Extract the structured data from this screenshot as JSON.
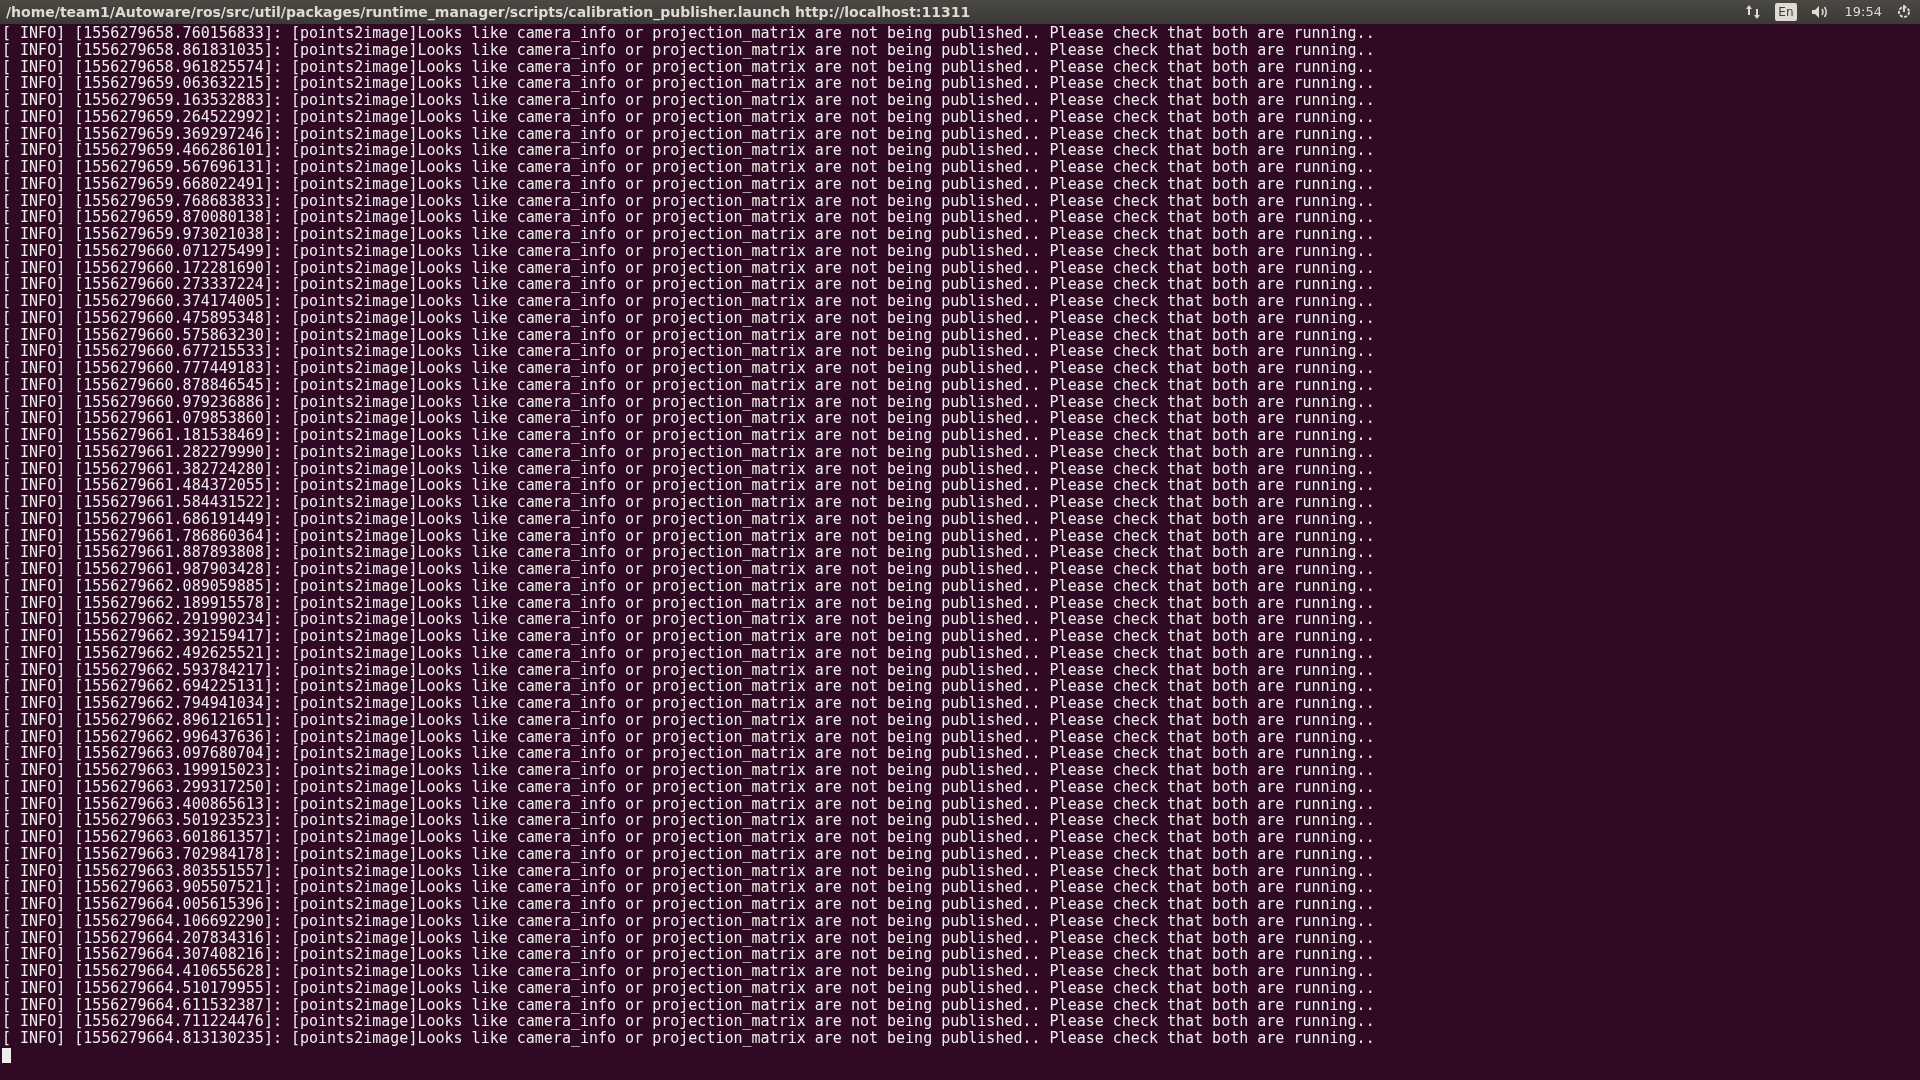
{
  "top_bar": {
    "title": "/home/team1/Autoware/ros/src/util/packages/runtime_manager/scripts/calibration_publisher.launch http://localhost:11311",
    "keyboard_layout": "En",
    "clock": "19:54"
  },
  "terminal": {
    "lines": [
      "[ INFO] [1556279658.760156833]: [points2image]Looks like camera_info or projection_matrix are not being published.. Please check that both are running..",
      "[ INFO] [1556279658.861831035]: [points2image]Looks like camera_info or projection_matrix are not being published.. Please check that both are running..",
      "[ INFO] [1556279658.961825574]: [points2image]Looks like camera_info or projection_matrix are not being published.. Please check that both are running..",
      "[ INFO] [1556279659.063632215]: [points2image]Looks like camera_info or projection_matrix are not being published.. Please check that both are running..",
      "[ INFO] [1556279659.163532883]: [points2image]Looks like camera_info or projection_matrix are not being published.. Please check that both are running..",
      "[ INFO] [1556279659.264522992]: [points2image]Looks like camera_info or projection_matrix are not being published.. Please check that both are running..",
      "[ INFO] [1556279659.369297246]: [points2image]Looks like camera_info or projection_matrix are not being published.. Please check that both are running..",
      "[ INFO] [1556279659.466286101]: [points2image]Looks like camera_info or projection_matrix are not being published.. Please check that both are running..",
      "[ INFO] [1556279659.567696131]: [points2image]Looks like camera_info or projection_matrix are not being published.. Please check that both are running..",
      "[ INFO] [1556279659.668022491]: [points2image]Looks like camera_info or projection_matrix are not being published.. Please check that both are running..",
      "[ INFO] [1556279659.768683833]: [points2image]Looks like camera_info or projection_matrix are not being published.. Please check that both are running..",
      "[ INFO] [1556279659.870080138]: [points2image]Looks like camera_info or projection_matrix are not being published.. Please check that both are running..",
      "[ INFO] [1556279659.973021038]: [points2image]Looks like camera_info or projection_matrix are not being published.. Please check that both are running..",
      "[ INFO] [1556279660.071275499]: [points2image]Looks like camera_info or projection_matrix are not being published.. Please check that both are running..",
      "[ INFO] [1556279660.172281690]: [points2image]Looks like camera_info or projection_matrix are not being published.. Please check that both are running..",
      "[ INFO] [1556279660.273337224]: [points2image]Looks like camera_info or projection_matrix are not being published.. Please check that both are running..",
      "[ INFO] [1556279660.374174005]: [points2image]Looks like camera_info or projection_matrix are not being published.. Please check that both are running..",
      "[ INFO] [1556279660.475895348]: [points2image]Looks like camera_info or projection_matrix are not being published.. Please check that both are running..",
      "[ INFO] [1556279660.575863230]: [points2image]Looks like camera_info or projection_matrix are not being published.. Please check that both are running..",
      "[ INFO] [1556279660.677215533]: [points2image]Looks like camera_info or projection_matrix are not being published.. Please check that both are running..",
      "[ INFO] [1556279660.777449183]: [points2image]Looks like camera_info or projection_matrix are not being published.. Please check that both are running..",
      "[ INFO] [1556279660.878846545]: [points2image]Looks like camera_info or projection_matrix are not being published.. Please check that both are running..",
      "[ INFO] [1556279660.979236886]: [points2image]Looks like camera_info or projection_matrix are not being published.. Please check that both are running..",
      "[ INFO] [1556279661.079853860]: [points2image]Looks like camera_info or projection_matrix are not being published.. Please check that both are running..",
      "[ INFO] [1556279661.181538469]: [points2image]Looks like camera_info or projection_matrix are not being published.. Please check that both are running..",
      "[ INFO] [1556279661.282279990]: [points2image]Looks like camera_info or projection_matrix are not being published.. Please check that both are running..",
      "[ INFO] [1556279661.382724280]: [points2image]Looks like camera_info or projection_matrix are not being published.. Please check that both are running..",
      "[ INFO] [1556279661.484372055]: [points2image]Looks like camera_info or projection_matrix are not being published.. Please check that both are running..",
      "[ INFO] [1556279661.584431522]: [points2image]Looks like camera_info or projection_matrix are not being published.. Please check that both are running..",
      "[ INFO] [1556279661.686191449]: [points2image]Looks like camera_info or projection_matrix are not being published.. Please check that both are running..",
      "[ INFO] [1556279661.786860364]: [points2image]Looks like camera_info or projection_matrix are not being published.. Please check that both are running..",
      "[ INFO] [1556279661.887893808]: [points2image]Looks like camera_info or projection_matrix are not being published.. Please check that both are running..",
      "[ INFO] [1556279661.987903428]: [points2image]Looks like camera_info or projection_matrix are not being published.. Please check that both are running..",
      "[ INFO] [1556279662.089059885]: [points2image]Looks like camera_info or projection_matrix are not being published.. Please check that both are running..",
      "[ INFO] [1556279662.189915578]: [points2image]Looks like camera_info or projection_matrix are not being published.. Please check that both are running..",
      "[ INFO] [1556279662.291990234]: [points2image]Looks like camera_info or projection_matrix are not being published.. Please check that both are running..",
      "[ INFO] [1556279662.392159417]: [points2image]Looks like camera_info or projection_matrix are not being published.. Please check that both are running..",
      "[ INFO] [1556279662.492625521]: [points2image]Looks like camera_info or projection_matrix are not being published.. Please check that both are running..",
      "[ INFO] [1556279662.593784217]: [points2image]Looks like camera_info or projection_matrix are not being published.. Please check that both are running..",
      "[ INFO] [1556279662.694225131]: [points2image]Looks like camera_info or projection_matrix are not being published.. Please check that both are running..",
      "[ INFO] [1556279662.794941034]: [points2image]Looks like camera_info or projection_matrix are not being published.. Please check that both are running..",
      "[ INFO] [1556279662.896121651]: [points2image]Looks like camera_info or projection_matrix are not being published.. Please check that both are running..",
      "[ INFO] [1556279662.996437636]: [points2image]Looks like camera_info or projection_matrix are not being published.. Please check that both are running..",
      "[ INFO] [1556279663.097680704]: [points2image]Looks like camera_info or projection_matrix are not being published.. Please check that both are running..",
      "[ INFO] [1556279663.199915023]: [points2image]Looks like camera_info or projection_matrix are not being published.. Please check that both are running..",
      "[ INFO] [1556279663.299317250]: [points2image]Looks like camera_info or projection_matrix are not being published.. Please check that both are running..",
      "[ INFO] [1556279663.400865613]: [points2image]Looks like camera_info or projection_matrix are not being published.. Please check that both are running..",
      "[ INFO] [1556279663.501923523]: [points2image]Looks like camera_info or projection_matrix are not being published.. Please check that both are running..",
      "[ INFO] [1556279663.601861357]: [points2image]Looks like camera_info or projection_matrix are not being published.. Please check that both are running..",
      "[ INFO] [1556279663.702984178]: [points2image]Looks like camera_info or projection_matrix are not being published.. Please check that both are running..",
      "[ INFO] [1556279663.803551557]: [points2image]Looks like camera_info or projection_matrix are not being published.. Please check that both are running..",
      "[ INFO] [1556279663.905507521]: [points2image]Looks like camera_info or projection_matrix are not being published.. Please check that both are running..",
      "[ INFO] [1556279664.005615396]: [points2image]Looks like camera_info or projection_matrix are not being published.. Please check that both are running..",
      "[ INFO] [1556279664.106692290]: [points2image]Looks like camera_info or projection_matrix are not being published.. Please check that both are running..",
      "[ INFO] [1556279664.207834316]: [points2image]Looks like camera_info or projection_matrix are not being published.. Please check that both are running..",
      "[ INFO] [1556279664.307408216]: [points2image]Looks like camera_info or projection_matrix are not being published.. Please check that both are running..",
      "[ INFO] [1556279664.410655628]: [points2image]Looks like camera_info or projection_matrix are not being published.. Please check that both are running..",
      "[ INFO] [1556279664.510179955]: [points2image]Looks like camera_info or projection_matrix are not being published.. Please check that both are running..",
      "[ INFO] [1556279664.611532387]: [points2image]Looks like camera_info or projection_matrix are not being published.. Please check that both are running..",
      "[ INFO] [1556279664.711224476]: [points2image]Looks like camera_info or projection_matrix are not being published.. Please check that both are running..",
      "[ INFO] [1556279664.813130235]: [points2image]Looks like camera_info or projection_matrix are not being published.. Please check that both are running.."
    ]
  }
}
